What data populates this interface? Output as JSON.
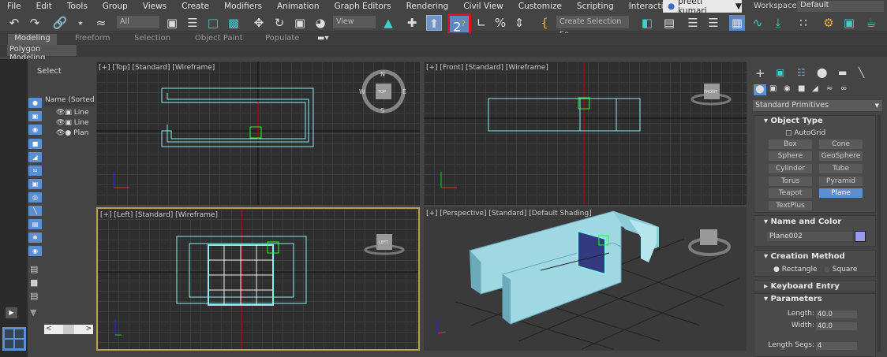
{
  "menu": [
    "File",
    "Edit",
    "Tools",
    "Group",
    "Views",
    "Create",
    "Modifiers",
    "Animation",
    "Graph Editors",
    "Rendering",
    "Civil View",
    "Customize",
    "Scripting",
    "Interactive"
  ],
  "user": {
    "name": "preeti kumari"
  },
  "workspaces": {
    "label": "Workspaces:",
    "value": "Default"
  },
  "toolbar": {
    "filter": "All",
    "ref_coord": "View",
    "selection_set": "Create Selection Se",
    "highlighted_tool": "angle-snap-toggle"
  },
  "ribbon": {
    "tabs": [
      "Modeling",
      "Freeform",
      "Selection",
      "Object Paint",
      "Populate"
    ],
    "active": "Modeling",
    "panel": "Polygon Modeling"
  },
  "explorer": {
    "title": "Select",
    "column": "Name (Sorted A",
    "items": [
      "Line",
      "Line",
      "Plan"
    ]
  },
  "viewports": [
    {
      "label": "[+] [Top] [Standard] [Wireframe]"
    },
    {
      "label": "[+] [Front] [Standard] [Wireframe]"
    },
    {
      "label": "[+] [Left] [Standard] [Wireframe]"
    },
    {
      "label": "[+] [Perspective] [Standard] [Default Shading]"
    }
  ],
  "viewcube": {
    "top": "TOP",
    "front": "FRONT",
    "left": "LEFT",
    "n": "N",
    "s": "S",
    "e": "E",
    "w": "W"
  },
  "command_panel": {
    "category": "Standard Primitives",
    "object_type": {
      "title": "Object Type",
      "autogrid": "AutoGrid",
      "buttons": [
        "Box",
        "Cone",
        "Sphere",
        "GeoSphere",
        "Cylinder",
        "Tube",
        "Torus",
        "Pyramid",
        "Teapot",
        "Plane",
        "TextPlus"
      ],
      "active": "Plane"
    },
    "name_color": {
      "title": "Name and Color",
      "name": "Plane002",
      "color": "#9999ee"
    },
    "creation": {
      "title": "Creation Method",
      "options": [
        "Rectangle",
        "Square"
      ],
      "selected": "Rectangle"
    },
    "keyboard": {
      "title": "Keyboard Entry"
    },
    "params": {
      "title": "Parameters",
      "length_label": "Length:",
      "length": "40.0",
      "width_label": "Width:",
      "width": "40.0",
      "lsegs_label": "Length Segs:",
      "lsegs": "4"
    }
  }
}
